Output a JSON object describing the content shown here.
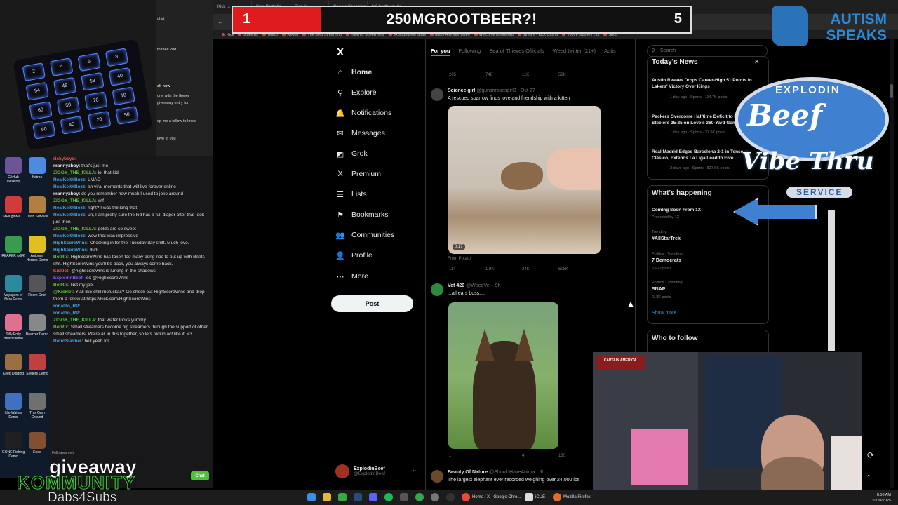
{
  "banner": {
    "left_number": "1",
    "title": "250MGROOTBEER?!",
    "right_number": "5"
  },
  "autism_logo": {
    "line1": "AUTISM",
    "line2": "SPEAKS"
  },
  "browser": {
    "tabs": [
      "Kick",
      "Your Portfolio",
      "Sign in",
      "Google Shopping",
      "bf6 battle royale - Google Sea"
    ],
    "bookmarks": [
      "Kick",
      "Stake.us",
      "Twitch",
      "Reddit",
      "The Best Streaming",
      "Internet Speed Test",
      "ExplodinBeef Stats",
      "Make Any Mix Video",
      "Welcome to Discord",
      "Stream - Kick Dashb",
      "Your Purpose | clot",
      "Shop"
    ]
  },
  "x_nav": {
    "logo": "X",
    "items": [
      {
        "label": "Home",
        "icon": "home-icon",
        "glyph": "⌂"
      },
      {
        "label": "Explore",
        "icon": "search-icon",
        "glyph": "⚲"
      },
      {
        "label": "Notifications",
        "icon": "bell-icon",
        "glyph": "🔔"
      },
      {
        "label": "Messages",
        "icon": "envelope-icon",
        "glyph": "✉"
      },
      {
        "label": "Grok",
        "icon": "grok-icon",
        "glyph": "◩"
      },
      {
        "label": "Premium",
        "icon": "x-premium-icon",
        "glyph": "X"
      },
      {
        "label": "Lists",
        "icon": "list-icon",
        "glyph": "☰"
      },
      {
        "label": "Bookmarks",
        "icon": "bookmark-icon",
        "glyph": "⚑"
      },
      {
        "label": "Communities",
        "icon": "people-icon",
        "glyph": "👥"
      },
      {
        "label": "Profile",
        "icon": "person-icon",
        "glyph": "👤"
      },
      {
        "label": "More",
        "icon": "more-icon",
        "glyph": "⋯"
      }
    ],
    "post_label": "Post",
    "profile_name": "ExplodinBeef",
    "profile_handle": "@ExplodinBeef",
    "profile_more": "···"
  },
  "feed": {
    "tabs": [
      "For you",
      "Following",
      "Sea of Thieves Officials",
      "Weed twitter (21+)",
      "Autis"
    ],
    "top_actions": [
      "205",
      "746",
      "11K",
      "58K"
    ],
    "tweets": [
      {
        "name": "Science girl",
        "handle": "@gunsnrosesgirl3 · Oct 27",
        "text": "A rescued sparrow finds love and friendship with a kitten",
        "video_time": "0:17",
        "from": "From Potato",
        "actions": [
          "114",
          "1.9K",
          "24K",
          "608K"
        ]
      },
      {
        "name": "Vet 420",
        "handle": "@WeedVet · 9h",
        "text": "...all ears boss....",
        "actions": [
          "1",
          "",
          "4",
          "130"
        ]
      },
      {
        "name": "Beauty Of Nature",
        "handle": "@ShouldHaveAnima · 6h",
        "text": "The largest elephant ever recorded weighing over 24,000 lbs"
      }
    ]
  },
  "sidebar": {
    "search_placeholder": "Search",
    "todays_news": {
      "title": "Today's News",
      "items": [
        {
          "headline": "Austin Reaves Drops Career-High 51 Points in Lakers' Victory Over Kings",
          "meta": "1 day ago · Sports · 114.7K posts"
        },
        {
          "headline": "Packers Overcome Halftime Deficit to Beat Steelers 35-25 on Love's 360-Yard Game",
          "meta": "1 day ago · Sports · 37.9K posts"
        },
        {
          "headline": "Real Madrid Edges Barcelona 2-1 in Tense Clásico, Extends La Liga Lead to Five",
          "meta": "2 days ago · Sports · 827.6K posts"
        }
      ]
    },
    "whats_happening": {
      "title": "What's happening",
      "promo_title": "Coming Soon From 1X",
      "promo_meta": "Promoted by 1X",
      "trends": [
        {
          "category": "Trending",
          "name": "#AllStarTrek",
          "posts": ""
        },
        {
          "category": "Politics · Trending",
          "name": "7 Democrats",
          "posts": "6,972 posts"
        },
        {
          "category": "Politics · Trending",
          "name": "SNAP",
          "posts": "912K posts"
        }
      ],
      "show_more": "Show more"
    },
    "who_to_follow": "Who to follow"
  },
  "beef_sign": {
    "top": "EXPLODIN",
    "main": "Beef",
    "vibe": "Vibe Thru",
    "service": "SERVICE"
  },
  "chat": {
    "lines": [
      {
        "user": "rickybeye:",
        "text": "",
        "color": "#e25a5a"
      },
      {
        "user": "mannyxboy:",
        "text": "that's just me",
        "color": "#e7e7e7"
      },
      {
        "user": "ZIGGY_THE_KILLA:",
        "text": "lol that kid",
        "color": "#53c23b"
      },
      {
        "user": "RealKeithBozz:",
        "text": "LMAO",
        "color": "#3fa0e0"
      },
      {
        "user": "RealKeithBozz:",
        "text": "ah viral moments that will live forever online",
        "color": "#3fa0e0"
      },
      {
        "user": "mannyxboy:",
        "text": "do you remember how much I used to joke around",
        "color": "#e7e7e7"
      },
      {
        "user": "ZIGGY_THE_KILLA:",
        "text": "wtf",
        "color": "#53c23b"
      },
      {
        "user": "RealKeithBozz:",
        "text": "right? I was thinking that",
        "color": "#3fa0e0"
      },
      {
        "user": "RealKeithBozz:",
        "text": "uh, I am pretty sure the kid has a full diaper after that look just then",
        "color": "#3fa0e0"
      },
      {
        "user": "ZIGGY_THE_KILLA:",
        "text": "golds are so sweet",
        "color": "#53c23b"
      },
      {
        "user": "RealKeithBozz:",
        "text": "wow that was impressive",
        "color": "#3fa0e0"
      },
      {
        "user": "HighScoreWins:",
        "text": "Checking in for the Tuesday day shift. Much love.",
        "color": "#3fa0e0"
      },
      {
        "user": "HighScoreWins:",
        "text": "!lurk",
        "color": "#3fa0e0"
      },
      {
        "user": "BotRix:",
        "text": "HighScoreWins has taken too many bong rips to put up with Beefs shit. HighScoreWins you'll be back, you always come back.",
        "color": "#53c23b"
      },
      {
        "user": "Kicklet:",
        "text": "@highscorewins is lurking in the shadows",
        "color": "#e25a5a"
      },
      {
        "user": "ExplodinBeef:",
        "text": "lso @HighScoreWins",
        "color": "#8a5cf0"
      },
      {
        "user": "BotRix:",
        "text": "Not my job.",
        "color": "#53c23b"
      },
      {
        "user": "@Kicklet:",
        "text": "Y'all like chill mofuckas? Go check out HighScoreWins and drop them a follow at https://kick.com/HighScoreWins",
        "color": "#53c23b"
      },
      {
        "user": "ronaldo_RP:",
        "text": "",
        "color": "#3fa0e0"
      },
      {
        "user": "ronaldo_RP:",
        "text": "",
        "color": "#3fa0e0"
      },
      {
        "user": "ZIGGY_THE_KILLA:",
        "text": "that water looks yummy",
        "color": "#53c23b"
      },
      {
        "user": "BotRix:",
        "text": "Small streamers become big streamers through the support of other small streamers. We're all in this together, so lets fuckin act like it! <3",
        "color": "#53c23b"
      },
      {
        "user": "RetroSlasher:",
        "text": "hell yeah lol",
        "color": "#3fa0e0"
      }
    ],
    "followers_only": "Followers only",
    "chat_button": "Chat"
  },
  "side_panel": {
    "title": "chat",
    "lines": [
      "to take 2nd",
      "ck now",
      "one with the flower",
      "giveaway entry for",
      "op me a follow to know",
      "love to you"
    ]
  },
  "desktop_icons": [
    {
      "label": "GitHub Desktop",
      "color": "#6e5494"
    },
    {
      "label": "Katran",
      "color": "#4c8be0"
    },
    {
      "label": "MPluginMa...",
      "color": "#d23b3b"
    },
    {
      "label": "Dash Survival",
      "color": "#b08040"
    },
    {
      "label": "REAPER (x64)",
      "color": "#3a9a50"
    },
    {
      "label": "Autogun Heroes Demo",
      "color": "#e0c020"
    },
    {
      "label": "Voyagers of Nera Demo",
      "color": "#2a8aa0"
    },
    {
      "label": "Room Onet",
      "color": "#555"
    },
    {
      "label": "Silly Polly Beast Demo",
      "color": "#e07090"
    },
    {
      "label": "Bearzer Demo",
      "color": "#888"
    },
    {
      "label": "Keep Digging",
      "color": "#9a7040"
    },
    {
      "label": "Slyders Demo",
      "color": "#c04040"
    },
    {
      "label": "Idle Waters Demo",
      "color": "#4070c0"
    },
    {
      "label": "This Gam Ground",
      "color": "#707070"
    },
    {
      "label": "GONE Fishing Demo",
      "color": "#202020"
    },
    {
      "label": "Endo",
      "color": "#805030"
    }
  ],
  "keypad_keys": [
    "2",
    "4",
    "6",
    "8",
    "54",
    "46",
    "58",
    "40",
    "60",
    "50",
    "70",
    "10",
    "50",
    "40",
    "20",
    "50"
  ],
  "overlay_text": {
    "giveaway": "giveaway",
    "kommunity": "KOMMUNITY",
    "dabs": "Dabs4Subs"
  },
  "webcam": {
    "poster_text": "CAPTAIN AMERICA"
  },
  "taskbar": {
    "items": [
      "Home / X - Google Chro...",
      "iCUE",
      "Mozilla Firefox"
    ],
    "time": "8:50 AM",
    "date": "10/28/2025"
  }
}
